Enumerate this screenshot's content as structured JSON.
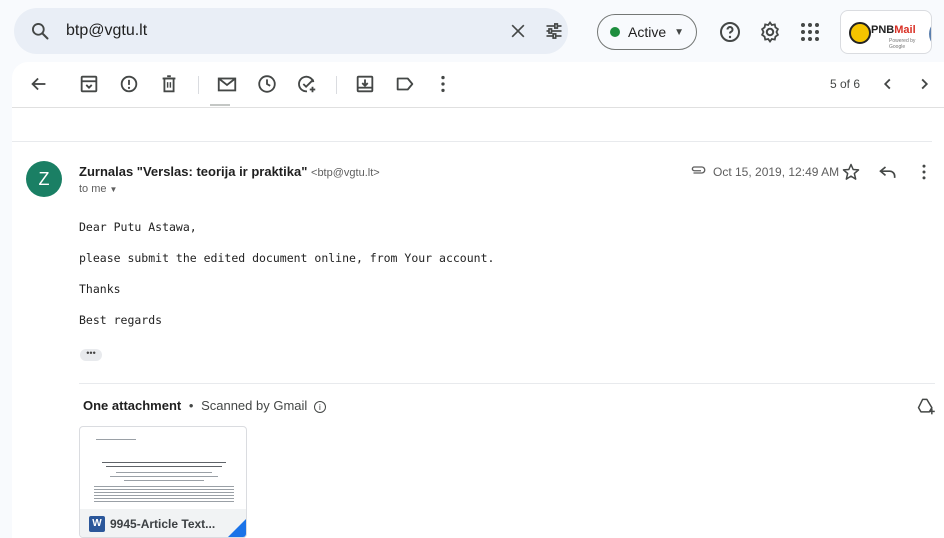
{
  "search": {
    "value": "btp@vgtu.lt",
    "icon": "search-icon"
  },
  "status": {
    "label": "Active",
    "color": "#1e8e3e"
  },
  "brand": {
    "logo_text_a": "PNB",
    "logo_text_b": "Mail",
    "logo_sub": "Powered by Google"
  },
  "toolbar": {
    "pager": "5 of 6"
  },
  "message": {
    "avatar_letter": "Z",
    "sender_name": "Zurnalas \"Verslas: teorija ir praktika\"",
    "sender_email": "<btp@vgtu.lt>",
    "to_label": "to me",
    "date": "Oct 15, 2019, 12:49 AM",
    "body": [
      "Dear Putu Astawa,",
      "please submit the edited document online, from Your account.",
      "Thanks",
      "Best regards"
    ],
    "ellipsis": "•••"
  },
  "attachments": {
    "heading": "One attachment",
    "separator": "•",
    "scan_note": "Scanned by Gmail",
    "file_name": "9945-Article Text...",
    "file_type_icon": "W"
  },
  "colors": {
    "accent": "#1a73e8",
    "avatar_bg": "#1a7f64",
    "word_blue": "#2b579a"
  }
}
